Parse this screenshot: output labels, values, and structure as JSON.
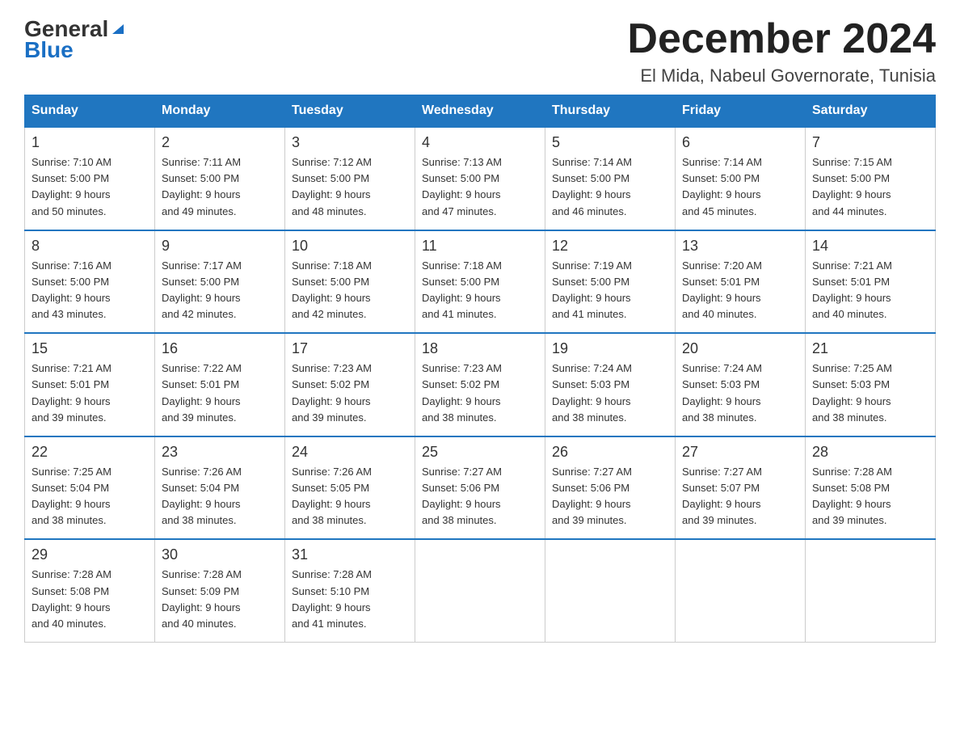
{
  "logo": {
    "general": "General",
    "blue": "Blue",
    "triangle": "▶"
  },
  "header": {
    "month_title": "December 2024",
    "location": "El Mida, Nabeul Governorate, Tunisia"
  },
  "weekdays": [
    "Sunday",
    "Monday",
    "Tuesday",
    "Wednesday",
    "Thursday",
    "Friday",
    "Saturday"
  ],
  "weeks": [
    [
      {
        "day": "1",
        "sunrise": "7:10 AM",
        "sunset": "5:00 PM",
        "daylight": "9 hours and 50 minutes."
      },
      {
        "day": "2",
        "sunrise": "7:11 AM",
        "sunset": "5:00 PM",
        "daylight": "9 hours and 49 minutes."
      },
      {
        "day": "3",
        "sunrise": "7:12 AM",
        "sunset": "5:00 PM",
        "daylight": "9 hours and 48 minutes."
      },
      {
        "day": "4",
        "sunrise": "7:13 AM",
        "sunset": "5:00 PM",
        "daylight": "9 hours and 47 minutes."
      },
      {
        "day": "5",
        "sunrise": "7:14 AM",
        "sunset": "5:00 PM",
        "daylight": "9 hours and 46 minutes."
      },
      {
        "day": "6",
        "sunrise": "7:14 AM",
        "sunset": "5:00 PM",
        "daylight": "9 hours and 45 minutes."
      },
      {
        "day": "7",
        "sunrise": "7:15 AM",
        "sunset": "5:00 PM",
        "daylight": "9 hours and 44 minutes."
      }
    ],
    [
      {
        "day": "8",
        "sunrise": "7:16 AM",
        "sunset": "5:00 PM",
        "daylight": "9 hours and 43 minutes."
      },
      {
        "day": "9",
        "sunrise": "7:17 AM",
        "sunset": "5:00 PM",
        "daylight": "9 hours and 42 minutes."
      },
      {
        "day": "10",
        "sunrise": "7:18 AM",
        "sunset": "5:00 PM",
        "daylight": "9 hours and 42 minutes."
      },
      {
        "day": "11",
        "sunrise": "7:18 AM",
        "sunset": "5:00 PM",
        "daylight": "9 hours and 41 minutes."
      },
      {
        "day": "12",
        "sunrise": "7:19 AM",
        "sunset": "5:00 PM",
        "daylight": "9 hours and 41 minutes."
      },
      {
        "day": "13",
        "sunrise": "7:20 AM",
        "sunset": "5:01 PM",
        "daylight": "9 hours and 40 minutes."
      },
      {
        "day": "14",
        "sunrise": "7:21 AM",
        "sunset": "5:01 PM",
        "daylight": "9 hours and 40 minutes."
      }
    ],
    [
      {
        "day": "15",
        "sunrise": "7:21 AM",
        "sunset": "5:01 PM",
        "daylight": "9 hours and 39 minutes."
      },
      {
        "day": "16",
        "sunrise": "7:22 AM",
        "sunset": "5:01 PM",
        "daylight": "9 hours and 39 minutes."
      },
      {
        "day": "17",
        "sunrise": "7:23 AM",
        "sunset": "5:02 PM",
        "daylight": "9 hours and 39 minutes."
      },
      {
        "day": "18",
        "sunrise": "7:23 AM",
        "sunset": "5:02 PM",
        "daylight": "9 hours and 38 minutes."
      },
      {
        "day": "19",
        "sunrise": "7:24 AM",
        "sunset": "5:03 PM",
        "daylight": "9 hours and 38 minutes."
      },
      {
        "day": "20",
        "sunrise": "7:24 AM",
        "sunset": "5:03 PM",
        "daylight": "9 hours and 38 minutes."
      },
      {
        "day": "21",
        "sunrise": "7:25 AM",
        "sunset": "5:03 PM",
        "daylight": "9 hours and 38 minutes."
      }
    ],
    [
      {
        "day": "22",
        "sunrise": "7:25 AM",
        "sunset": "5:04 PM",
        "daylight": "9 hours and 38 minutes."
      },
      {
        "day": "23",
        "sunrise": "7:26 AM",
        "sunset": "5:04 PM",
        "daylight": "9 hours and 38 minutes."
      },
      {
        "day": "24",
        "sunrise": "7:26 AM",
        "sunset": "5:05 PM",
        "daylight": "9 hours and 38 minutes."
      },
      {
        "day": "25",
        "sunrise": "7:27 AM",
        "sunset": "5:06 PM",
        "daylight": "9 hours and 38 minutes."
      },
      {
        "day": "26",
        "sunrise": "7:27 AM",
        "sunset": "5:06 PM",
        "daylight": "9 hours and 39 minutes."
      },
      {
        "day": "27",
        "sunrise": "7:27 AM",
        "sunset": "5:07 PM",
        "daylight": "9 hours and 39 minutes."
      },
      {
        "day": "28",
        "sunrise": "7:28 AM",
        "sunset": "5:08 PM",
        "daylight": "9 hours and 39 minutes."
      }
    ],
    [
      {
        "day": "29",
        "sunrise": "7:28 AM",
        "sunset": "5:08 PM",
        "daylight": "9 hours and 40 minutes."
      },
      {
        "day": "30",
        "sunrise": "7:28 AM",
        "sunset": "5:09 PM",
        "daylight": "9 hours and 40 minutes."
      },
      {
        "day": "31",
        "sunrise": "7:28 AM",
        "sunset": "5:10 PM",
        "daylight": "9 hours and 41 minutes."
      },
      null,
      null,
      null,
      null
    ]
  ],
  "labels": {
    "sunrise_prefix": "Sunrise: ",
    "sunset_prefix": "Sunset: ",
    "daylight_prefix": "Daylight: "
  }
}
